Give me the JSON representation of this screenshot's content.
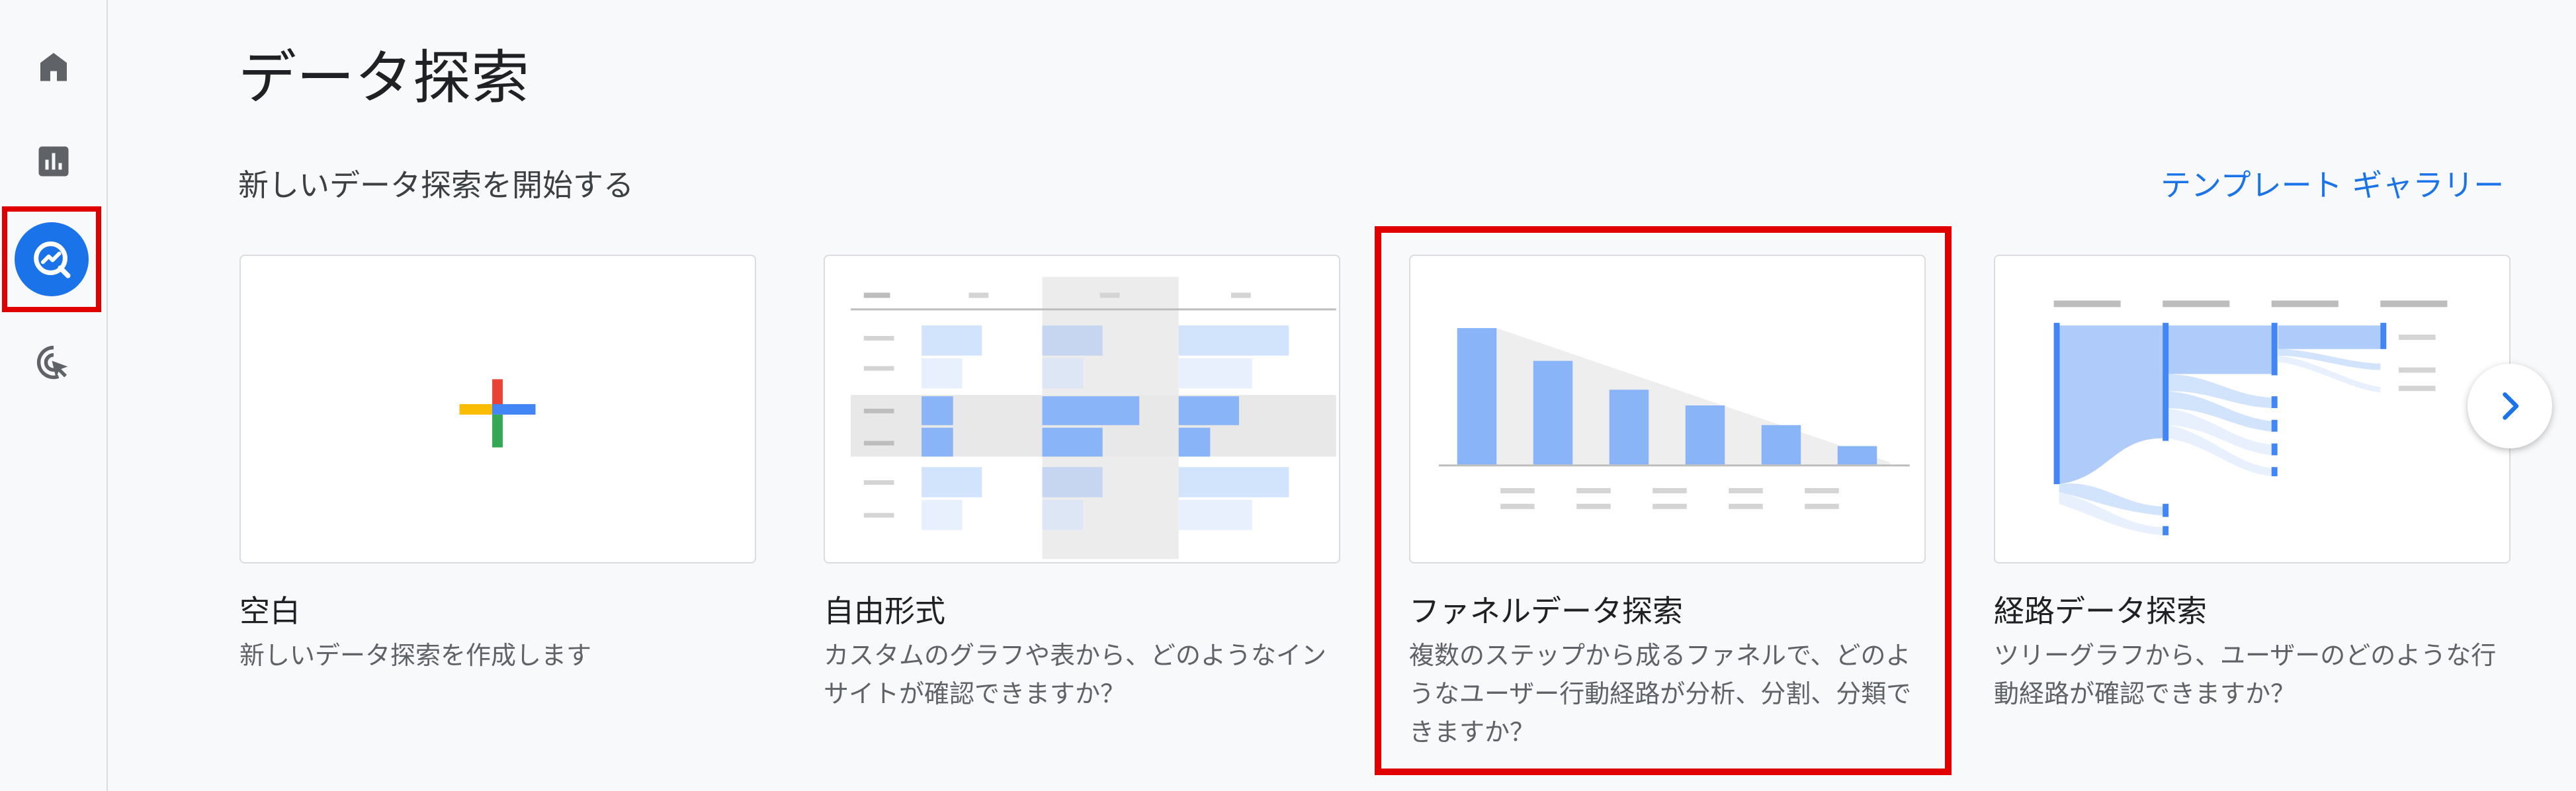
{
  "nav": {
    "items": [
      {
        "icon": "home-icon"
      },
      {
        "icon": "reports-icon"
      },
      {
        "icon": "explore-icon",
        "selected": true
      },
      {
        "icon": "advertising-icon"
      }
    ]
  },
  "header": {
    "title": "データ探索"
  },
  "section": {
    "heading": "新しいデータ探索を開始する",
    "gallery_link": "テンプレート ギャラリー"
  },
  "cards": [
    {
      "title": "空白",
      "description": "新しいデータ探索を作成します"
    },
    {
      "title": "自由形式",
      "description": "カスタムのグラフや表から、どのようなインサイトが確認できますか？"
    },
    {
      "title": "ファネルデータ探索",
      "description": "複数のステップから成るファネルで、どのようなユーザー行動経路が分析、分割、分類できますか？",
      "highlighted": true
    },
    {
      "title": "経路データ探索",
      "description": "ツリーグラフから、ユーザーのどのような行動経路が確認できますか？"
    }
  ],
  "carousel": {
    "next_icon": "chevron-right-icon"
  },
  "colors": {
    "accent": "#1a73e8",
    "highlight": "#e00000",
    "thumb_blue": "#8ab4f8",
    "thumb_light_blue": "#d2e3fc"
  }
}
